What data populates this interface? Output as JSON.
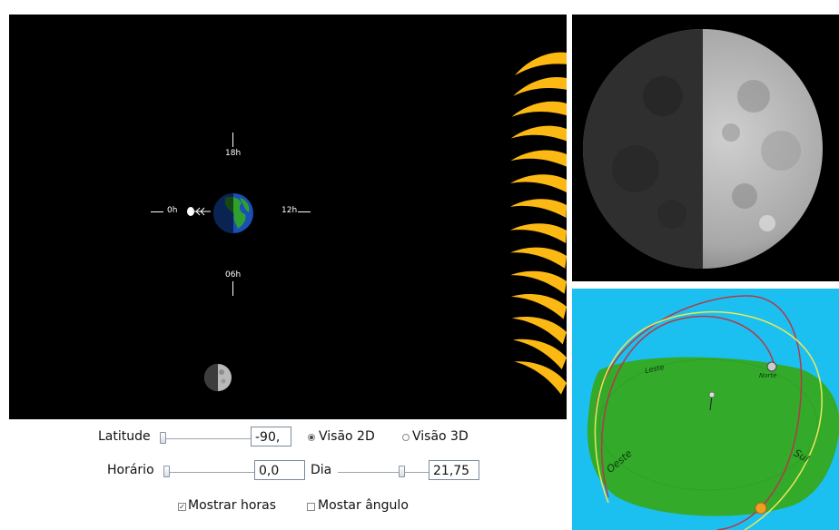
{
  "main_view": {
    "hour_labels": {
      "top": "18h",
      "left": "0h",
      "right": "12h",
      "bottom": "06h"
    }
  },
  "controls": {
    "latitude": {
      "label": "Latitude",
      "value": "-90,",
      "slider_fraction": 0.0
    },
    "horario": {
      "label": "Horário",
      "value": "0,0",
      "slider_fraction": 0.0
    },
    "dia": {
      "label": "Dia",
      "value": "21,75",
      "slider_fraction": 0.83
    },
    "view_mode": {
      "options": [
        "Visão 2D",
        "Visão 3D"
      ],
      "selected": "Visão 2D"
    },
    "checkboxes": [
      {
        "label": "Mostrar horas",
        "checked": true
      },
      {
        "label": "Mostar ângulo",
        "checked": false
      }
    ]
  },
  "sky_view": {
    "compass": {
      "leste": "Leste",
      "oeste": "Oeste",
      "sul": "Sul",
      "norte": "Norte"
    }
  },
  "colors": {
    "sun": "#fdb913",
    "sky": "#1cc0f0",
    "ground": "#33aa2a",
    "earth_ocean": "#1a4fb5",
    "earth_land": "#2fa02f",
    "orbit_red": "#b23a48",
    "orbit_yellow": "#e8e85a"
  }
}
